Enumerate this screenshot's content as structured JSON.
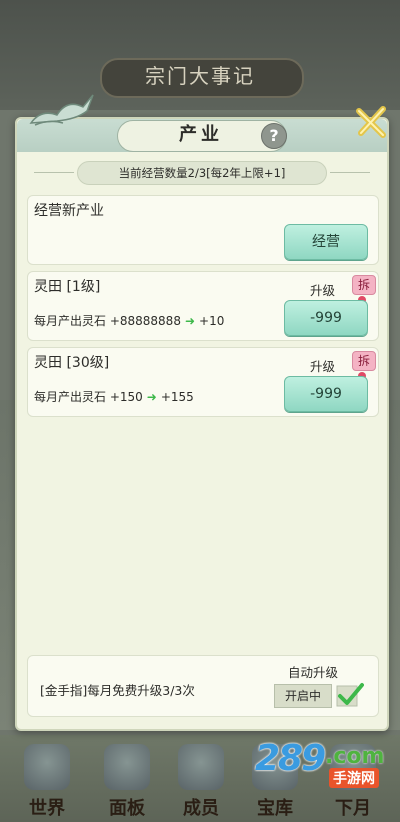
{
  "background": {
    "title": "宗门大事记",
    "nav": [
      {
        "label": "世界"
      },
      {
        "label": "面板"
      },
      {
        "label": "成员"
      },
      {
        "label": "宝库"
      },
      {
        "label": "下月"
      }
    ],
    "watermark": {
      "number": "289",
      "domain": ".com",
      "sub": "手游网"
    }
  },
  "dialog": {
    "title": "产业",
    "help_icon": "?",
    "count_text": "当前经营数量2/3[每2年上限+1]",
    "new_business": {
      "title": "经营新产业",
      "button": "经营"
    },
    "items": [
      {
        "title": "灵田 [1级]",
        "desc_prefix": "每月产出灵石 +88888888",
        "desc_suffix": "+10",
        "upgrade_label": "升级",
        "cost": "-999",
        "dismantle": "拆"
      },
      {
        "title": "灵田 [30级]",
        "desc_prefix": "每月产出灵石 +150",
        "desc_suffix": "+155",
        "upgrade_label": "升级",
        "cost": "-999",
        "dismantle": "拆"
      }
    ],
    "auto": {
      "free_text": "[金手指]每月免费升级3/3次",
      "label": "自动升级",
      "toggle_text": "开启中",
      "checked": true
    }
  }
}
